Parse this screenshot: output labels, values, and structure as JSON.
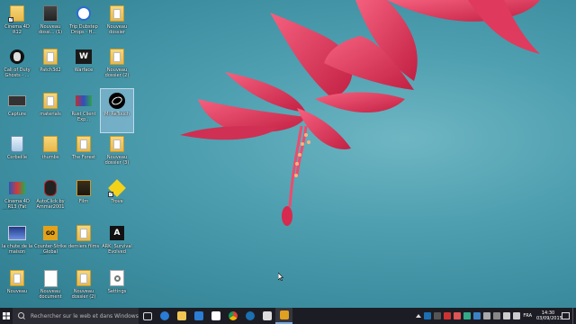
{
  "desktop": {
    "icons": [
      {
        "label": "Cinema 4D R12",
        "icon": "folder-icon"
      },
      {
        "label": "Nouveau dossi... (1)",
        "icon": "folder-icon"
      },
      {
        "label": "Trip Dubstep Drops - H...",
        "icon": "audio-file-icon"
      },
      {
        "label": "Nouveau dossier",
        "icon": "folder-icon"
      },
      {
        "label": "Call of Duty Ghosts - ...",
        "icon": "cod-game-icon"
      },
      {
        "label": "Patch3d2",
        "icon": "folder-icon"
      },
      {
        "label": "Warface",
        "icon": "warface-icon"
      },
      {
        "label": "Nouveau dossier (2)",
        "icon": "folder-icon"
      },
      {
        "label": "Capture",
        "icon": "capture-icon"
      },
      {
        "label": "materials",
        "icon": "folder-icon"
      },
      {
        "label": "Rust Client Exp...",
        "icon": "rust-client-icon"
      },
      {
        "label": "Mi ReTouch",
        "icon": "app-logo-icon"
      },
      {
        "label": "Corbeille",
        "icon": "recycle-bin-icon"
      },
      {
        "label": "thumbs",
        "icon": "folder-icon"
      },
      {
        "label": "The Forest",
        "icon": "game-folder-icon"
      },
      {
        "label": "Nouveau dossier (3)",
        "icon": "folder-icon"
      },
      {
        "label": "Cinema 4D R13 (Fat MrBadoom...",
        "icon": "cinema4d-icon"
      },
      {
        "label": "AutoClick by Ammar2001",
        "icon": "mouse-icon"
      },
      {
        "label": "Film",
        "icon": "film-folder-icon"
      },
      {
        "label": "Trove",
        "icon": "trove-icon"
      },
      {
        "label": "la chute de la maison blanche",
        "icon": "video-file-icon"
      },
      {
        "label": "Counter-Strike Global Offensive",
        "icon": "csgo-icon"
      },
      {
        "label": "derniers films",
        "icon": "folder-icon"
      },
      {
        "label": "ARK: Survival Evolved",
        "icon": "ark-icon"
      },
      {
        "label": "Nouveau",
        "icon": "folder-icon"
      },
      {
        "label": "Nouveau document texte",
        "icon": "text-document-icon"
      },
      {
        "label": "Nouveau dossier (2)",
        "icon": "folder-icon"
      },
      {
        "label": "Settings",
        "icon": "settings-icon"
      }
    ]
  },
  "taskbar": {
    "search_placeholder": "Rechercher sur le web et dans Windows",
    "apps": [
      "task-view-icon",
      "edge-icon",
      "file-explorer-icon",
      "store-icon",
      "windows-icon",
      "chrome-icon",
      "steam-icon",
      "pinned-app-icon",
      "active-app-icon"
    ],
    "language": "FRA",
    "time": "14:30",
    "date": "03/09/2015"
  },
  "colors": {
    "wallpaper": "#4fa0b1",
    "flower": "#e83a5a",
    "taskbar": "#1c1d24"
  }
}
